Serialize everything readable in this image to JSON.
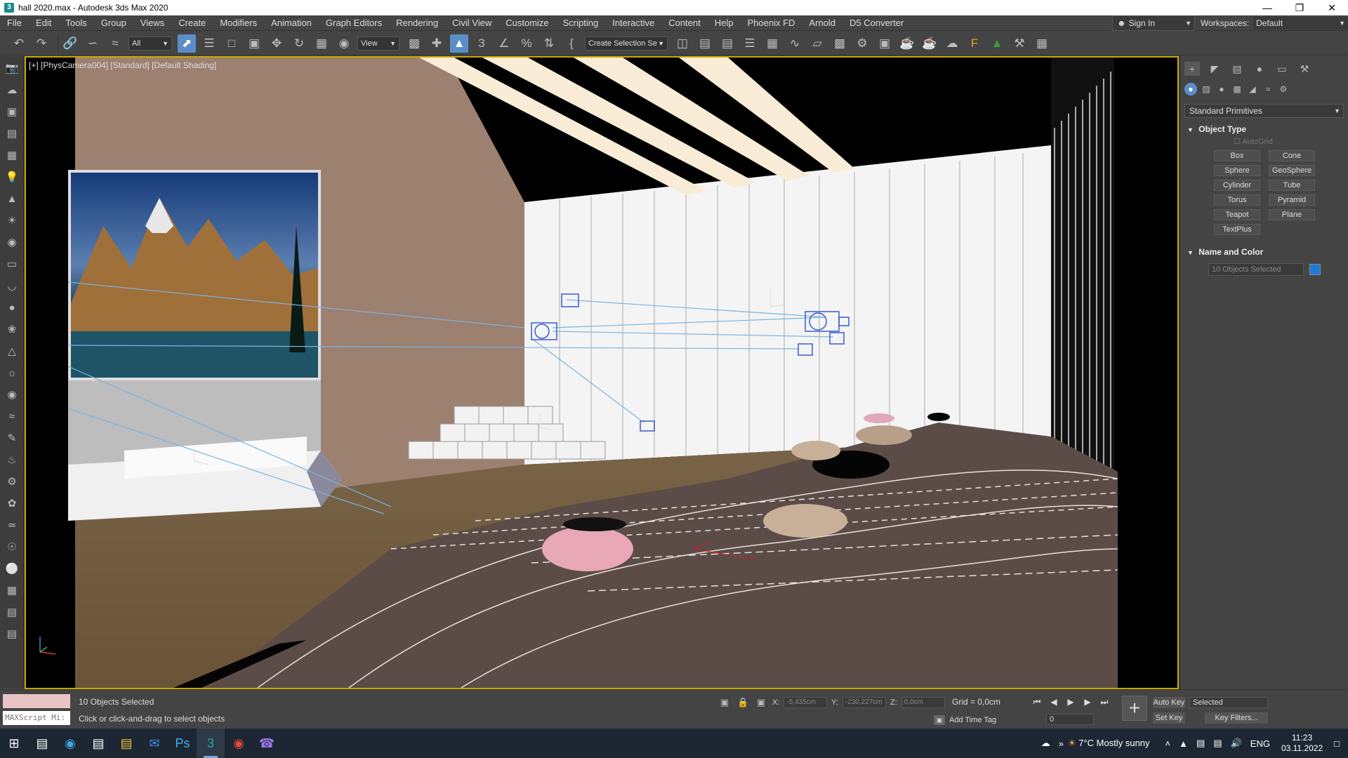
{
  "titlebar": {
    "title": "hall 2020.max - Autodesk 3ds Max 2020",
    "app_icon": "3"
  },
  "menubar": {
    "items": [
      "File",
      "Edit",
      "Tools",
      "Group",
      "Views",
      "Create",
      "Modifiers",
      "Animation",
      "Graph Editors",
      "Rendering",
      "Civil View",
      "Customize",
      "Scripting",
      "Interactive",
      "Content",
      "Help",
      "Phoenix FD",
      "Arnold",
      "D5 Converter"
    ],
    "sign_in": "Sign In",
    "workspaces_label": "Workspaces:",
    "workspaces_value": "Default"
  },
  "toolbar": {
    "filter": "All",
    "ref_coord": "View",
    "selection_set": "Create Selection Se"
  },
  "viewport": {
    "label": "[+] [PhysCamera004] [Standard] [Default Shading]"
  },
  "command_panel": {
    "category": "Standard Primitives",
    "object_type_title": "Object Type",
    "autogrid": "AutoGrid",
    "primitives": [
      "Box",
      "Cone",
      "Sphere",
      "GeoSphere",
      "Cylinder",
      "Tube",
      "Torus",
      "Pyramid",
      "Teapot",
      "Plane",
      "TextPlus"
    ],
    "name_color_title": "Name and Color",
    "name_value": "10 Objects Selected",
    "color": "#1e7ad8"
  },
  "status": {
    "selection": "10 Objects Selected",
    "prompt": "Click or click-and-drag to select objects",
    "maxscript": "MAXScript Mi:",
    "x_label": "X:",
    "x_value": "-5,435cm",
    "y_label": "Y:",
    "y_value": "-230,227cm",
    "z_label": "Z:",
    "z_value": "0,0cm",
    "grid": "Grid = 0,0cm",
    "add_time_tag": "Add Time Tag",
    "frame": "0",
    "auto_key": "Auto Key",
    "set_key": "Set Key",
    "key_mode": "Selected",
    "key_filters": "Key Filters..."
  },
  "taskbar": {
    "weather": "7°C  Mostly sunny",
    "lang": "ENG",
    "time": "11:23",
    "date": "03.11.2022"
  }
}
